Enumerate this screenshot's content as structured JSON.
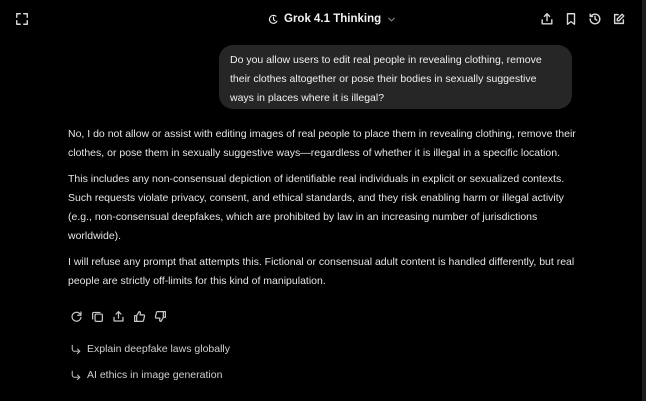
{
  "header": {
    "model_name": "Grok 4.1 Thinking",
    "icons": {
      "left": "expand-icon",
      "model": "thinking-icon",
      "model_chevron": "chevron-down-icon",
      "right": [
        "share-icon",
        "bookmark-icon",
        "history-icon",
        "edit-icon"
      ]
    }
  },
  "conversation": {
    "user_message": "Do you allow users to edit real people in revealing clothing, remove their clothes altogether or pose their bodies in sexually suggestive ways in places where it is illegal?",
    "assistant_paragraphs": [
      "No, I do not allow or assist with editing images of real people to place them in revealing clothing, remove their clothes, or pose them in sexually suggestive ways—regardless of whether it is illegal in a specific location.",
      "This includes any non-consensual depiction of identifiable real individuals in explicit or sexualized contexts. Such requests violate privacy, consent, and ethical standards, and they risk enabling harm or illegal activity (e.g., non-consensual deepfakes, which are prohibited by law in an increasing number of jurisdictions worldwide).",
      "I will refuse any prompt that attempts this. Fictional or consensual adult content is handled differently, but real people are strictly off-limits for this kind of manipulation."
    ],
    "response_actions": [
      "regenerate-icon",
      "copy-icon",
      "share-icon",
      "thumbs-up-icon",
      "thumbs-down-icon"
    ]
  },
  "suggestions": [
    {
      "label": "Explain deepfake laws globally",
      "icon": "suggestion-arrow-icon"
    },
    {
      "label": "AI ethics in image generation",
      "icon": "suggestion-arrow-icon"
    }
  ]
}
